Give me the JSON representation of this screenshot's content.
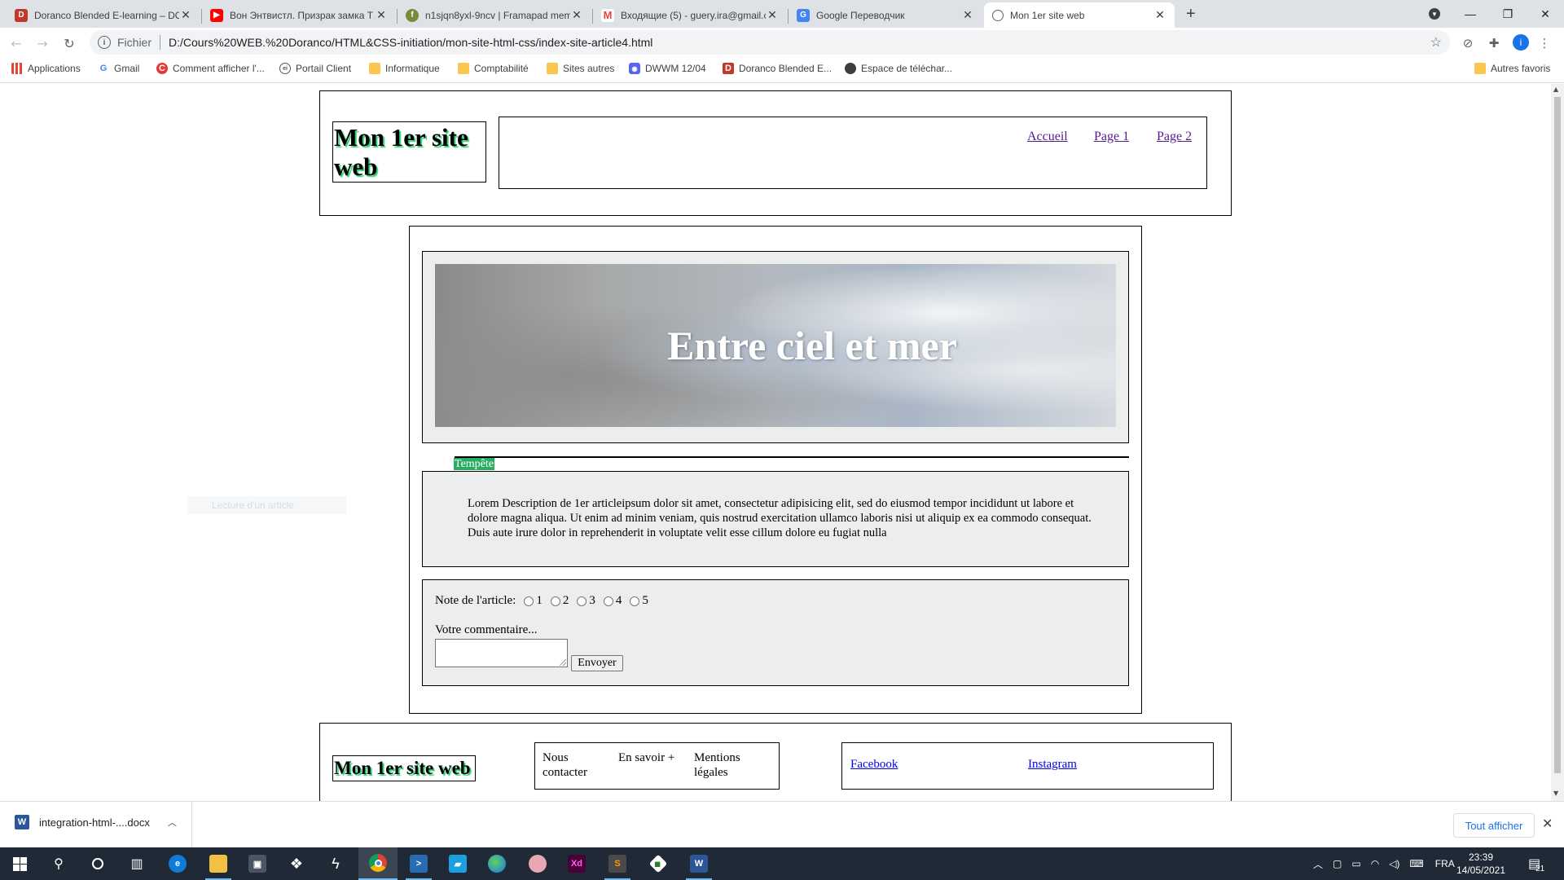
{
  "tabs": [
    {
      "title": "Doranco Blended E-learning – DO",
      "favicon": "doranco-icon",
      "color": "#c0392b"
    },
    {
      "title": "Вон Энтвистл. Призрак замка Т…",
      "favicon": "youtube-icon",
      "color": "#ff0000"
    },
    {
      "title": "n1sjqn8yxl-9ncv | Framapad mem…",
      "favicon": "framapad-icon",
      "color": "#7a8a3a"
    },
    {
      "title": "Входящие (5) - guery.ira@gmail.c…",
      "favicon": "gmail-icon",
      "color": "#ea4335"
    },
    {
      "title": "Google Переводчик",
      "favicon": "translate-icon",
      "color": "#4285f4"
    },
    {
      "title": "Mon 1er site web",
      "favicon": "globe-icon",
      "color": "#5f6368"
    }
  ],
  "address": {
    "scheme": "Fichier",
    "url": "D:/Cours%20WEB.%20Doranco/HTML&CSS-initiation/mon-site-html-css/index-site-article4.html"
  },
  "profile_initial": "i",
  "bookmarks": [
    {
      "label": "Applications",
      "icon": "apps-grid-icon"
    },
    {
      "label": "Gmail",
      "icon": "google-icon"
    },
    {
      "label": "Comment afficher l'...",
      "icon": "c-red-icon"
    },
    {
      "label": "Portail Client",
      "icon": "portal-icon"
    },
    {
      "label": "Informatique",
      "icon": "folder-icon"
    },
    {
      "label": "Comptabilité",
      "icon": "folder-icon"
    },
    {
      "label": "Sites autres",
      "icon": "folder-icon"
    },
    {
      "label": "DWWM 12/04",
      "icon": "discord-icon"
    },
    {
      "label": "Doranco Blended E...",
      "icon": "doranco-icon"
    },
    {
      "label": "Espace de téléchar...",
      "icon": "download-space-icon"
    }
  ],
  "bookmarks_other": "Autres favoris",
  "site": {
    "title": "Mon 1er site web",
    "nav": [
      "Accueil",
      "Page 1",
      "Page 2"
    ],
    "hero_title": "Entre ciel et mer",
    "legend": "Tempête",
    "article_text": "Lorem Description de 1er articleipsum dolor sit amet, consectetur adipisicing elit, sed do eiusmod tempor incididunt ut labore et dolore magna aliqua. Ut enim ad minim veniam, quis nostrud exercitation ullamco laboris nisi ut aliquip ex ea commodo consequat. Duis aute irure dolor in reprehenderit in voluptate velit esse cillum dolore eu fugiat nulla",
    "rating_label": "Note de l'article:",
    "rating_options": [
      "1",
      "2",
      "3",
      "4",
      "5"
    ],
    "comment_label": "Votre commentaire...",
    "submit_label": "Envoyer",
    "ghost_text": "Lecture d'un article",
    "footer": {
      "title": "Mon 1er site web",
      "links": [
        "Nous contacter",
        "En savoir +",
        "Mentions légales"
      ],
      "social": [
        "Facebook",
        "Instagram"
      ]
    }
  },
  "download": {
    "filename": "integration-html-....docx",
    "show_all": "Tout afficher"
  },
  "taskbar": {
    "lang": "FRA",
    "time": "23:39",
    "date": "14/05/2021",
    "notifications": "21"
  }
}
